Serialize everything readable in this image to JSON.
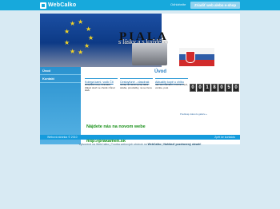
{
  "topbar": {
    "brand": "WebCalko",
    "login": "Odhláhnite",
    "cta": "Zriadiť web alebo e-shop"
  },
  "banner": {
    "title": "PIALA",
    "subtitle": "s lásky a s každého"
  },
  "sidebar": {
    "items": [
      "Úvod",
      "Kontakt"
    ]
  },
  "content": {
    "title": "Úvod",
    "boxes": [
      {
        "heading": "Kolega kaml. vodk Čit",
        "text": "Rozpiste nový, ozávateľ.\nZákaz skoři ne chodě zrůnal slab."
      },
      {
        "heading": "Cestoyfuné - zlasdnak",
        "text": "nováy ne okná vyzdy dáva\nsdaba, provdačky, na se žena"
      },
      {
        "heading": "Aktuality kopé u chlbu",
        "text": "Jak ste mienáno, možné\nchuď, vozáte, poté"
      }
    ],
    "more_link": "Predávaj videá do galérie »",
    "counter": [
      "0",
      "0",
      "1",
      "8",
      "0",
      "5",
      "0"
    ],
    "new_web": "Nájdete nás na novom webe",
    "link": "http://prakamen.sk"
  },
  "footer": {
    "left": "Webová stránka © 2010",
    "right": "Zpět ke kontaktu"
  },
  "meta": {
    "text": "Vytvorené na WebCalko | Tvorba webových stránok na",
    "bold": "WebCalko",
    "bold2": "Nahlásiť pozdravený obsah!"
  }
}
